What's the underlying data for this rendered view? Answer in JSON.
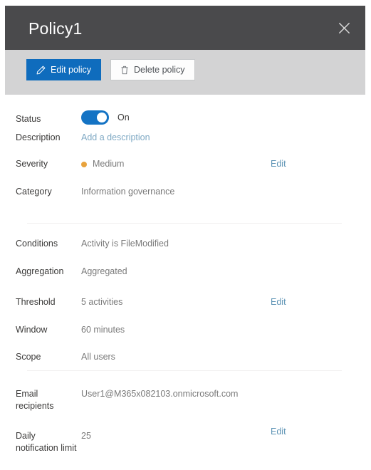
{
  "header": {
    "title": "Policy1",
    "close_icon": "close-icon"
  },
  "command_bar": {
    "edit_policy_label": "Edit policy",
    "edit_policy_icon": "pencil-icon",
    "delete_policy_label": "Delete policy",
    "delete_policy_icon": "trash-icon"
  },
  "colors": {
    "header_background": "#4a4a4c",
    "command_bar_background": "#d3d3d4",
    "primary_button": "#0f6cbd",
    "toggle_on": "#1473c4",
    "severity_medium_dot": "#e8a33d",
    "link": "#5d93b5"
  },
  "details": {
    "status": {
      "label": "Status",
      "toggle_state": "On",
      "toggle_value_label": "On"
    },
    "description": {
      "label": "Description",
      "value": "Add a description"
    },
    "severity": {
      "label": "Severity",
      "value": "Medium",
      "edit_label": "Edit"
    },
    "category": {
      "label": "Category",
      "value": "Information governance"
    },
    "conditions": {
      "label": "Conditions",
      "value": "Activity is FileModified"
    },
    "aggregation": {
      "label": "Aggregation",
      "value": "Aggregated"
    },
    "threshold": {
      "label": "Threshold",
      "value": "5 activities",
      "edit_label": "Edit"
    },
    "window": {
      "label": "Window",
      "value": "60 minutes"
    },
    "scope": {
      "label": "Scope",
      "value": "All users"
    },
    "email_recipients": {
      "label": "Email recipients",
      "value": "User1@M365x082103.onmicrosoft.com"
    },
    "daily_notification_limit": {
      "label": "Daily notification limit",
      "value": "25",
      "edit_label": "Edit"
    }
  }
}
